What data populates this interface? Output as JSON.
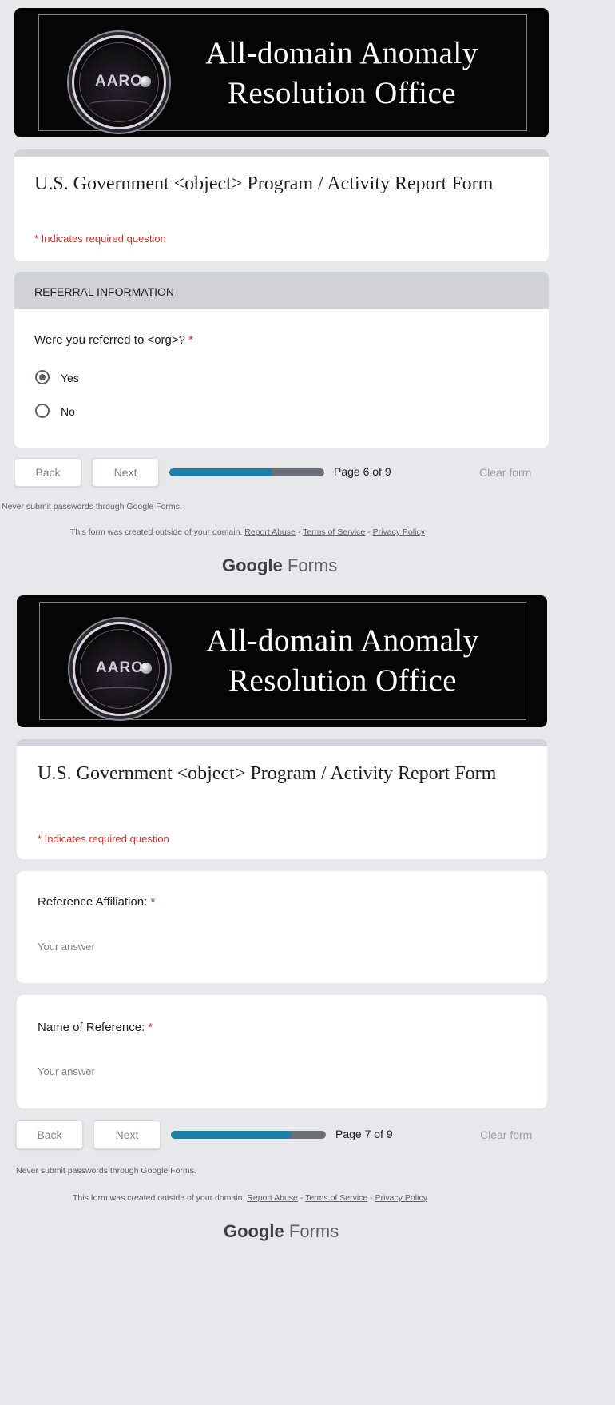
{
  "banner": {
    "logo_text": "AARO",
    "title_line1": "All-domain Anomaly",
    "title_line2": "Resolution Office"
  },
  "form": {
    "title": "U.S. Government  <object> Program / Activity Report Form",
    "required_note": "* Indicates required question"
  },
  "page6": {
    "section_header": "REFERRAL INFORMATION",
    "question": "Were you referred to <org>? ",
    "required_star": "*",
    "options": [
      {
        "label": "Yes",
        "selected": true
      },
      {
        "label": "No",
        "selected": false
      }
    ],
    "back": "Back",
    "next": "Next",
    "page_label": "Page 6 of 9",
    "progress": 0.667,
    "clear": "Clear form"
  },
  "page7": {
    "q1": "Reference Affiliation: ",
    "q2": "Name of Reference: ",
    "required_star": "*",
    "answer_placeholder": "Your answer",
    "back": "Back",
    "next": "Next",
    "page_label": "Page 7 of 9",
    "progress": 0.778,
    "clear": "Clear form"
  },
  "footer": {
    "warning": "Never submit passwords through Google Forms.",
    "domain_note": "This form was created outside of your domain. ",
    "report_abuse": "Report Abuse",
    "sep": " - ",
    "terms": "Terms of Service",
    "privacy": "Privacy Policy",
    "brand_google": "Google",
    "brand_forms": " Forms"
  },
  "colors": {
    "background": "#e7e8ea",
    "banner": "#050505",
    "progress_fill": "#1d7fa6",
    "progress_track": "#6b6f76",
    "required": "#d93025"
  }
}
